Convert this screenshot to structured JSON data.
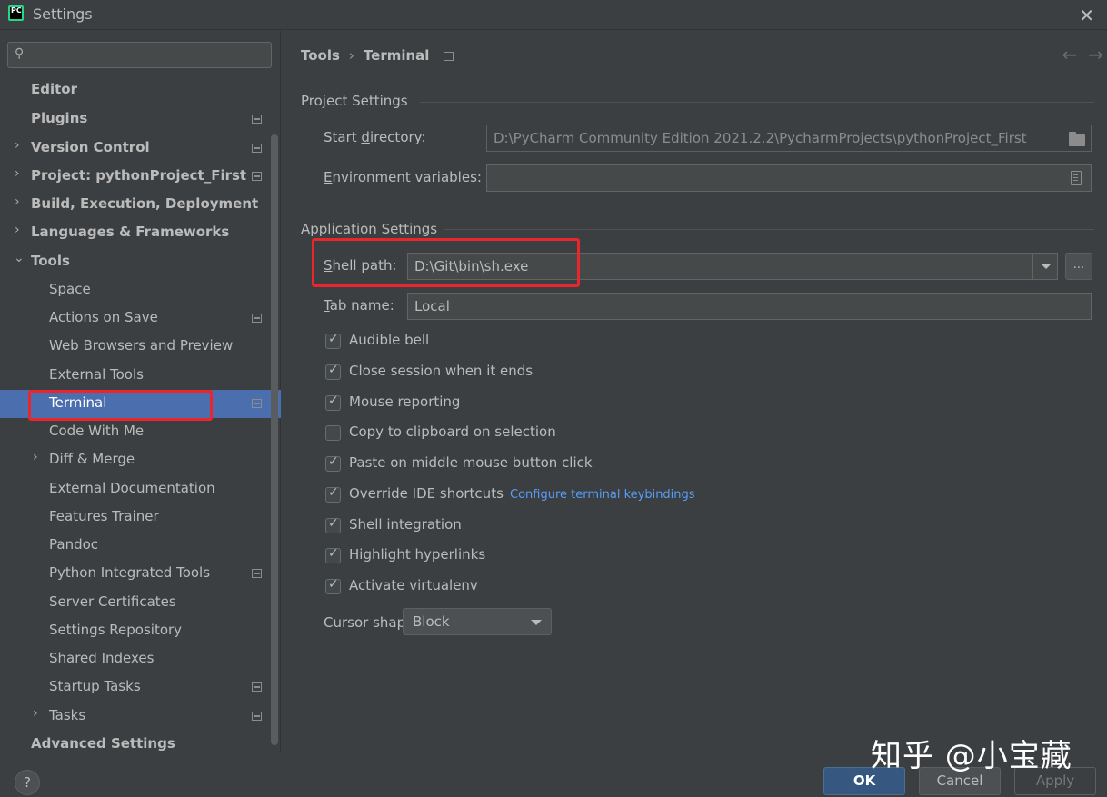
{
  "window": {
    "title": "Settings",
    "app_icon_text": "PC"
  },
  "search": {
    "placeholder": ""
  },
  "sidebar": {
    "items": [
      {
        "label": "Editor"
      },
      {
        "label": "Plugins"
      },
      {
        "label": "Version Control"
      },
      {
        "label": "Project: pythonProject_First"
      },
      {
        "label": "Build, Execution, Deployment"
      },
      {
        "label": "Languages & Frameworks"
      },
      {
        "label": "Tools"
      },
      {
        "label": "Space"
      },
      {
        "label": "Actions on Save"
      },
      {
        "label": "Web Browsers and Preview"
      },
      {
        "label": "External Tools"
      },
      {
        "label": "Terminal"
      },
      {
        "label": "Code With Me"
      },
      {
        "label": "Diff & Merge"
      },
      {
        "label": "External Documentation"
      },
      {
        "label": "Features Trainer"
      },
      {
        "label": "Pandoc"
      },
      {
        "label": "Python Integrated Tools"
      },
      {
        "label": "Server Certificates"
      },
      {
        "label": "Settings Repository"
      },
      {
        "label": "Shared Indexes"
      },
      {
        "label": "Startup Tasks"
      },
      {
        "label": "Tasks"
      },
      {
        "label": "Advanced Settings"
      }
    ],
    "selected": "Terminal"
  },
  "breadcrumb": {
    "parent": "Tools",
    "separator": "›",
    "current": "Terminal"
  },
  "nav": {
    "back": "←",
    "forward": "→"
  },
  "project_settings": {
    "title": "Project Settings",
    "start_directory_label_pre": "Start ",
    "start_directory_label_u": "d",
    "start_directory_label_post": "irectory:",
    "start_directory_value": "D:\\PyCharm Community Edition 2021.2.2\\PycharmProjects\\pythonProject_First",
    "env_label_u": "E",
    "env_label_post": "nvironment variables:",
    "env_value": ""
  },
  "application_settings": {
    "title": "Application Settings",
    "shell_path_label_u": "S",
    "shell_path_label_post": "hell path:",
    "shell_path_value": "D:\\Git\\bin\\sh.exe",
    "browse_label": "...",
    "tab_name_label_u": "T",
    "tab_name_label_post": "ab name:",
    "tab_name_value": "Local",
    "checkboxes": [
      {
        "label": "Audible bell",
        "checked": true
      },
      {
        "label": "Close session when it ends",
        "checked": true
      },
      {
        "label": "Mouse reporting",
        "checked": true
      },
      {
        "label": "Copy to clipboard on selection",
        "checked": false
      },
      {
        "label": "Paste on middle mouse button click",
        "checked": true
      },
      {
        "label": "Override IDE shortcuts",
        "checked": true
      },
      {
        "label": "Shell integration",
        "checked": true
      },
      {
        "label": "Highlight hyperlinks",
        "checked": true
      },
      {
        "label": "Activate virtualenv",
        "checked": true
      }
    ],
    "keybindings_link": "Configure terminal keybindings",
    "cursor_shape_label": "Cursor shape:",
    "cursor_shape_value": "Block"
  },
  "footer": {
    "help": "?",
    "ok": "OK",
    "cancel": "Cancel",
    "apply": "Apply"
  },
  "watermark": "知乎 @小宝藏",
  "colors": {
    "background": "#3c3f41",
    "selection": "#4b6eaf",
    "highlight_red": "#e8262b",
    "link": "#589df6",
    "ok_button": "#365880"
  }
}
